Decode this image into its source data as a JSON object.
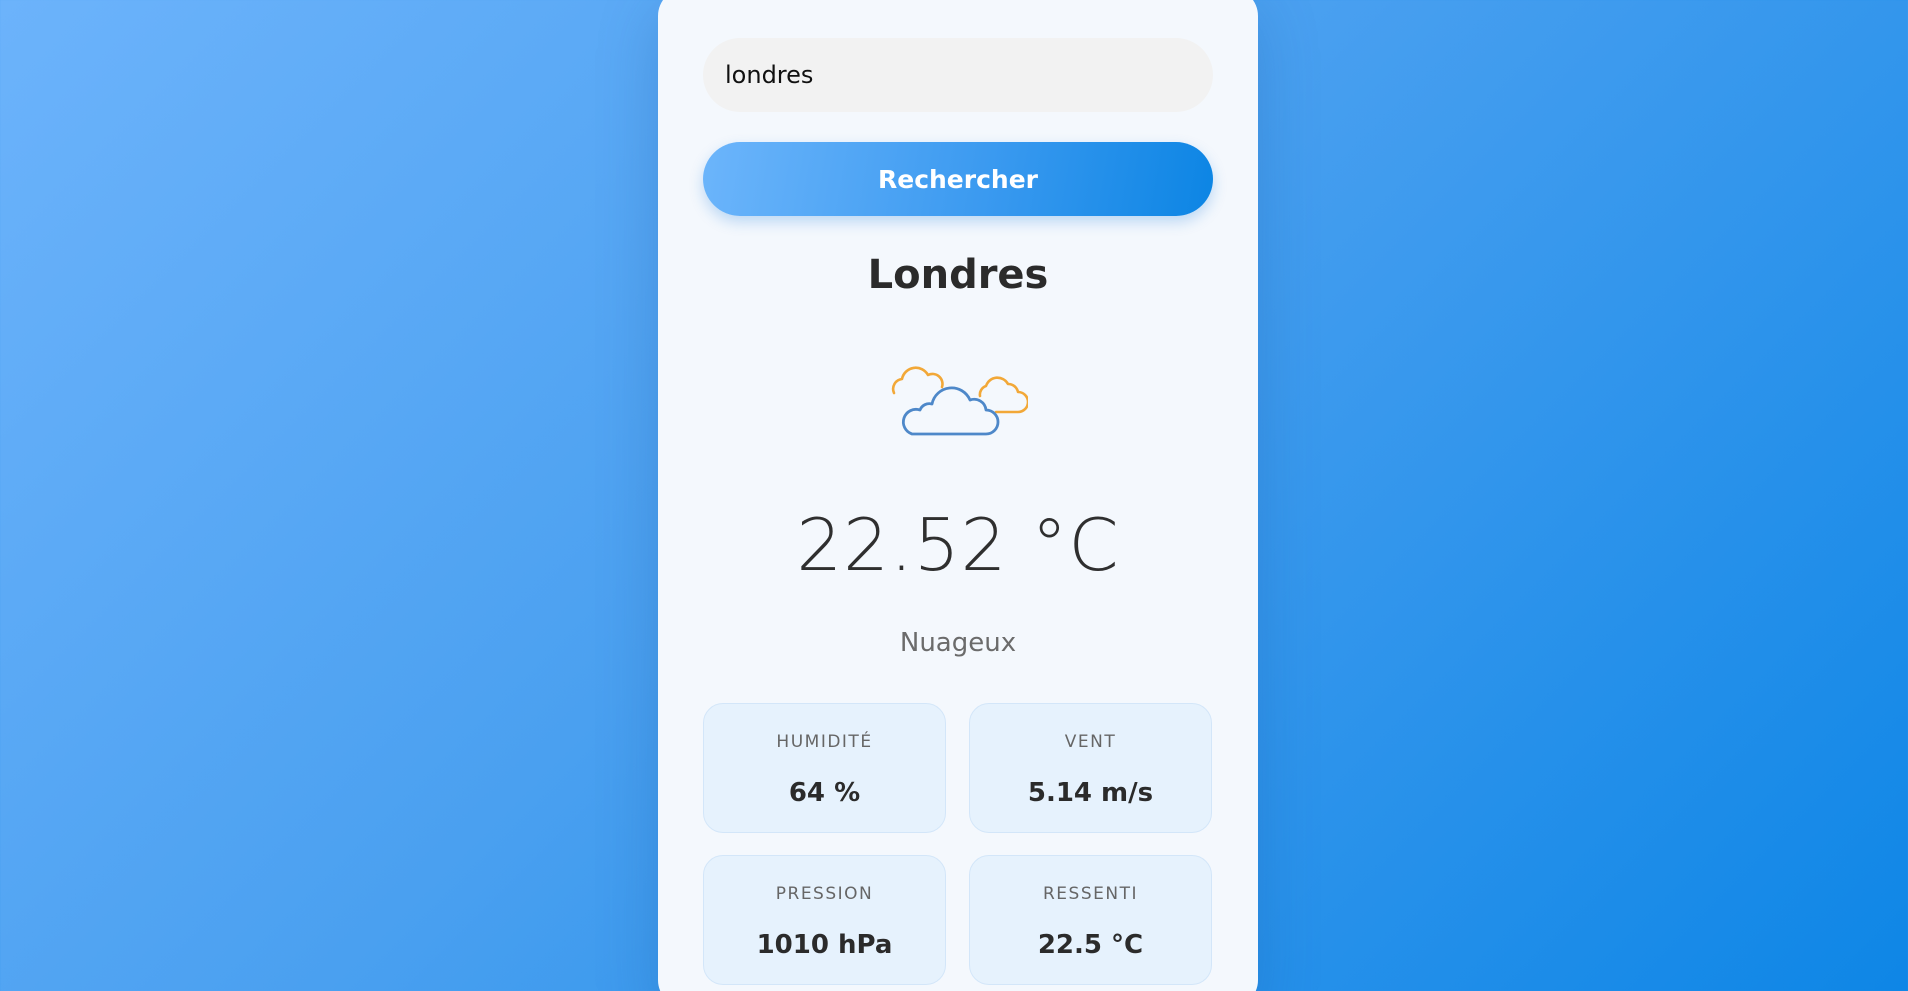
{
  "search": {
    "value": "londres",
    "button_label": "Rechercher"
  },
  "weather": {
    "city": "Londres",
    "icon": "clouds-icon",
    "temperature": "22.52 °C",
    "description": "Nuageux"
  },
  "stats": [
    {
      "label": "HUMIDITÉ",
      "value": "64 %"
    },
    {
      "label": "VENT",
      "value": "5.14 m/s"
    },
    {
      "label": "PRESSION",
      "value": "1010 hPa"
    },
    {
      "label": "RESSENTI",
      "value": "22.5 °C"
    }
  ],
  "colors": {
    "background_start": "#6cb3fb",
    "background_end": "#0e86e6",
    "card": "#f4f8fd",
    "button_start": "#6cb5fb",
    "button_end": "#0c85e4",
    "stat_tile": "#e6f2fd",
    "cloud_front": "#4e88c9",
    "cloud_back": "#f2a838"
  }
}
